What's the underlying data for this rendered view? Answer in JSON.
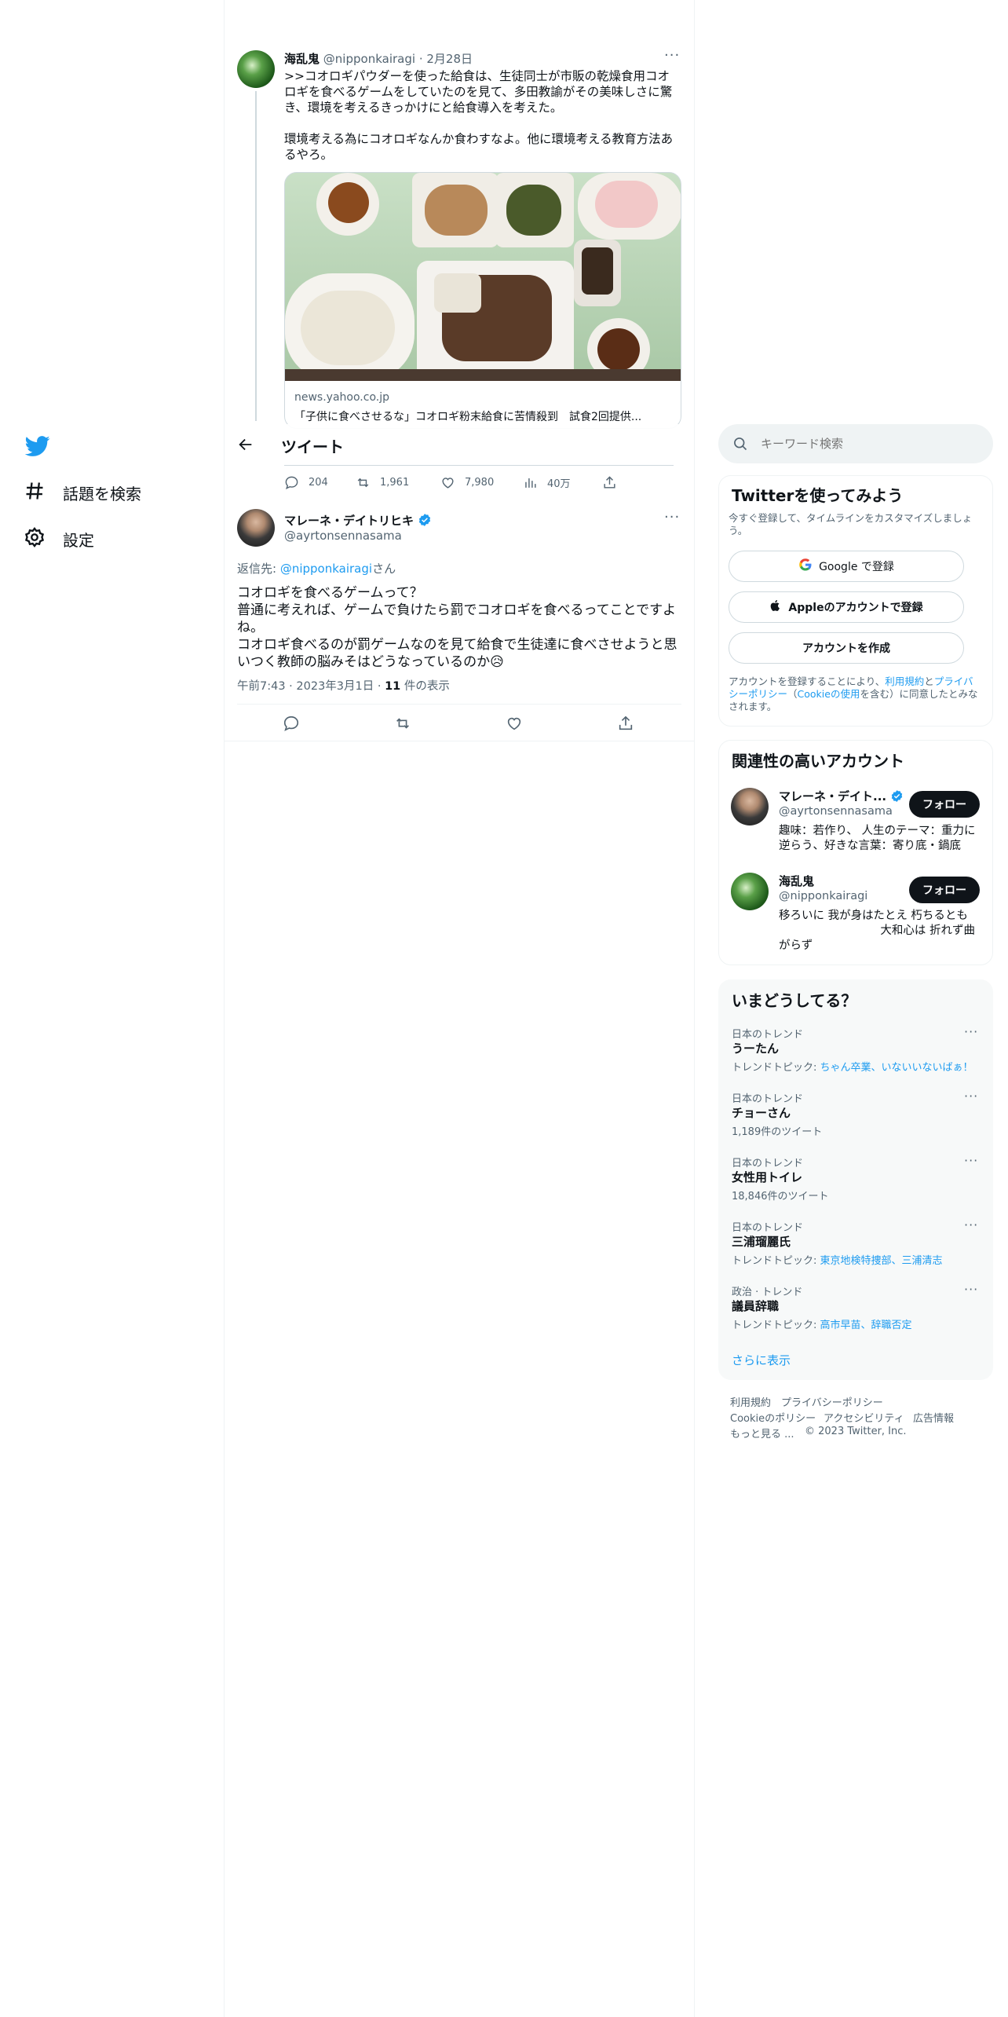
{
  "nav": {
    "logo": "twitter-bird-icon",
    "explore_label": "話題を検索",
    "settings_label": "設定"
  },
  "header": {
    "title": "ツイート"
  },
  "quoted_tweet": {
    "author_name": "海乱鬼",
    "author_handle": "@nipponkairagi",
    "date": "2月28日",
    "text": ">>コオロギパウダーを使った給食は、生徒同士が市販の乾燥食用コオロギを食べるゲームをしていたのを見て、多田教諭がその美味しさに驚き、環境を考えるきっかけにと給食導入を考えた。\n\n環境考える為にコオロギなんか食わすなよ。他に環境考える教育方法あるやろ。",
    "card_domain": "news.yahoo.co.jp",
    "card_title": "「子供に食べさせるな」コオロギ粉末給食に苦情殺到　試食2回提供...",
    "replies": "204",
    "retweets": "1,961",
    "likes": "7,980",
    "views": "40万"
  },
  "main_tweet": {
    "author_name": "マレーネ・デイトリヒキ",
    "author_handle": "@ayrtonsennasama",
    "reply_to_prefix": "返信先: ",
    "reply_to_handle": "@nipponkairagi",
    "reply_to_suffix": "さん",
    "text": "コオロギを食べるゲームって？\n普通に考えれば、ゲームで負けたら罰でコオロギを食べるってことですよね。\nコオロギ食べるのが罰ゲームなのを見て給食で生徒達に食べさせようと思いつく教師の脳みそはどうなっているのか😥",
    "timestamp": "午前7:43 · 2023年3月1日 · ",
    "views_count": "11",
    "views_label": " 件の表示"
  },
  "search": {
    "placeholder": "キーワード検索"
  },
  "signup": {
    "title": "Twitterを使ってみよう",
    "subtitle": "今すぐ登録して、タイムラインをカスタマイズしましょう。",
    "google_label": "Google で登録",
    "apple_label": "Appleのアカウントで登録",
    "create_label": "アカウントを作成",
    "terms_prefix": "アカウントを登録することにより、",
    "terms_link": "利用規約",
    "terms_and": "と",
    "privacy_link": "プライバシーポリシー",
    "cookie_open": "（",
    "cookie_link": "Cookieの使用",
    "terms_suffix": "を含む）に同意したとみなされます。"
  },
  "related": {
    "title": "関連性の高いアカウント",
    "accounts": [
      {
        "name": "マレーネ・デイト...",
        "handle": "@ayrtonsennasama",
        "bio": "趣味：若作り、 人生のテーマ：重力に逆らう、好きな言葉：寄り底・鍋底",
        "follow_label": "フォロー"
      },
      {
        "name": "海乱鬼",
        "handle": "@nipponkairagi",
        "bio_line1": "移ろいに 我が身はたとえ 朽ちるとも",
        "bio_line2": "大和心は 折れず曲",
        "bio_line3": "がらず",
        "follow_label": "フォロー"
      }
    ]
  },
  "trends": {
    "title": "いまどうしてる？",
    "items": [
      {
        "context": "日本のトレンド",
        "name": "うーたん",
        "sub_prefix": "トレンドトピック: ",
        "sub_link": "ちゃん卒業、いないいないばぁ！"
      },
      {
        "context": "日本のトレンド",
        "name": "チョーさん",
        "sub": "1,189件のツイート"
      },
      {
        "context": "日本のトレンド",
        "name": "女性用トイレ",
        "sub": "18,846件のツイート"
      },
      {
        "context": "日本のトレンド",
        "name": "三浦瑠麗氏",
        "sub_prefix": "トレンドトピック: ",
        "sub_link": "東京地検特捜部、三浦清志"
      },
      {
        "context": "政治 · トレンド",
        "name": "議員辞職",
        "sub_prefix": "トレンドトピック: ",
        "sub_link": "高市早苗、辞職否定"
      }
    ],
    "show_more": "さらに表示"
  },
  "footer": {
    "terms": "利用規約",
    "privacy": "プライバシーポリシー",
    "cookie": "Cookieのポリシー",
    "accessibility": "アクセシビリティ",
    "ads": "広告情報",
    "more": "もっと見る ...",
    "copyright": "© 2023 Twitter, Inc."
  },
  "colors": {
    "accent": "#1d9bf0",
    "text": "#0f1419",
    "muted": "#536471",
    "border": "#eff3f4"
  }
}
